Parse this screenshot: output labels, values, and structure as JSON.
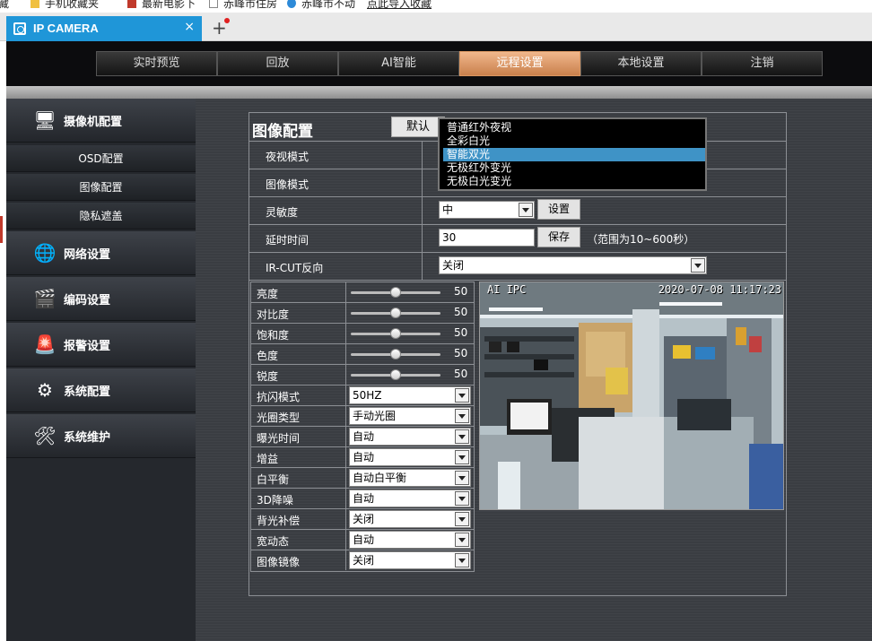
{
  "bookmarks": [
    {
      "label": "藏"
    },
    {
      "label": "手机收藏夹"
    },
    {
      "label": "最新电影下"
    },
    {
      "label": "赤峰市住房"
    },
    {
      "label": "赤峰市不动"
    },
    {
      "label": "点此导入收藏"
    }
  ],
  "browser_tab": {
    "title": "IP CAMERA",
    "close": "×",
    "new_tab": "+"
  },
  "nav": {
    "items": [
      {
        "label": "实时预览"
      },
      {
        "label": "回放"
      },
      {
        "label": "AI智能"
      },
      {
        "label": "远程设置",
        "active": true
      },
      {
        "label": "本地设置"
      },
      {
        "label": "注销"
      }
    ],
    "active_color": "#e0a070"
  },
  "sidebar": {
    "camera_config": "摄像机配置",
    "sub_items": [
      "OSD配置",
      "图像配置",
      "隐私遮盖"
    ],
    "network": "网络设置",
    "encoding": "编码设置",
    "alarm": "报警设置",
    "system_config": "系统配置",
    "system_maintain": "系统维护",
    "icons": [
      "monitor-icon",
      "network-icon",
      "clapperboard-icon",
      "alarm-icon",
      "gear-icon",
      "tools-icon"
    ]
  },
  "panel": {
    "title": "图像配置",
    "default_button": "默认",
    "rows": {
      "night_mode": "夜视模式",
      "image_mode": "图像模式",
      "sensitivity": "灵敏度",
      "delay": "延时时间",
      "ircut": "IR-CUT反向"
    },
    "sensitivity_value": "中",
    "set_button": "设置",
    "delay_value": "30",
    "save_button": "保存",
    "delay_hint": "（范围为10~600秒）",
    "ircut_value": "关闭",
    "dropdown": {
      "options": [
        "普通红外夜视",
        "全彩白光",
        "智能双光",
        "无极红外变光",
        "无极白光变光"
      ],
      "selected": "智能双光"
    }
  },
  "params": {
    "sliders": [
      {
        "label": "亮度",
        "value": "50",
        "level": 0.5
      },
      {
        "label": "对比度",
        "value": "50",
        "level": 0.5
      },
      {
        "label": "饱和度",
        "value": "50",
        "level": 0.5
      },
      {
        "label": "色度",
        "value": "50",
        "level": 0.5
      },
      {
        "label": "锐度",
        "value": "50",
        "level": 0.5
      }
    ],
    "selects": [
      {
        "label": "抗闪模式",
        "value": "50HZ"
      },
      {
        "label": "光圈类型",
        "value": "手动光圈"
      },
      {
        "label": "曝光时间",
        "value": "自动"
      },
      {
        "label": "增益",
        "value": "自动"
      },
      {
        "label": "白平衡",
        "value": "自动白平衡"
      },
      {
        "label": "3D降噪",
        "value": "自动"
      },
      {
        "label": "背光补偿",
        "value": "关闭"
      },
      {
        "label": "宽动态",
        "value": "自动"
      },
      {
        "label": "图像镜像",
        "value": "关闭"
      }
    ]
  },
  "video": {
    "osd_name": "AI IPC",
    "osd_time": "2020-07-08 11:17:23"
  }
}
